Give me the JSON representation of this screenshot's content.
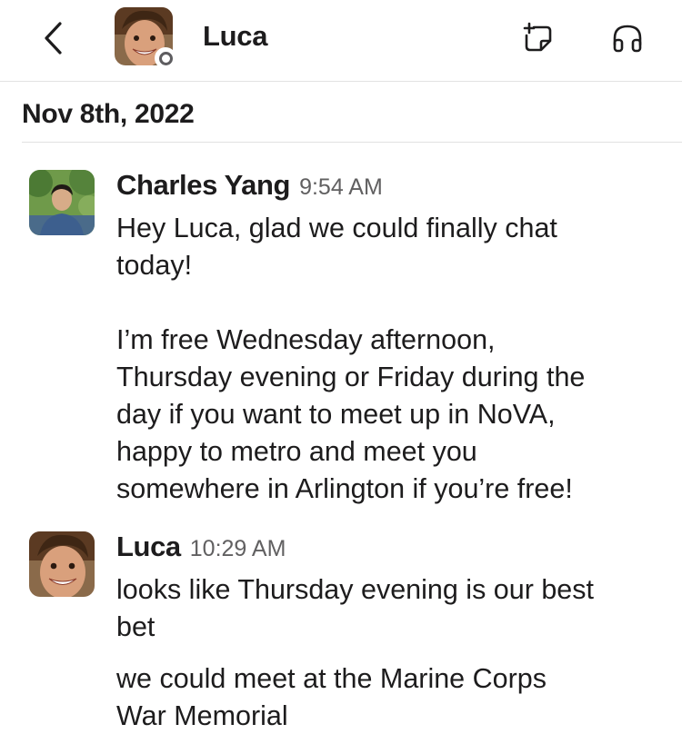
{
  "header": {
    "title": "Luca",
    "back_icon": "chevron-left-icon",
    "compose_icon": "new-canvas-icon",
    "huddle_icon": "headphones-icon",
    "presence": "away"
  },
  "date_divider": "Nov 8th, 2022",
  "messages": [
    {
      "sender": "Charles Yang",
      "time": "9:54 AM",
      "paragraphs": [
        "Hey Luca, glad we could finally chat\ntoday!",
        "I’m free Wednesday afternoon,\nThursday evening or Friday during the\nday if you want to meet up in NoVA,\nhappy to metro and meet you\nsomewhere in Arlington if you’re free!"
      ]
    },
    {
      "sender": "Luca",
      "time": "10:29 AM",
      "paragraphs": [
        "looks like Thursday evening is our best\nbet",
        "we could meet at the Marine Corps\nWar Memorial"
      ]
    }
  ],
  "colors": {
    "text": "#1d1c1d",
    "timestamp": "#616061",
    "divider": "#e2e2e2"
  }
}
